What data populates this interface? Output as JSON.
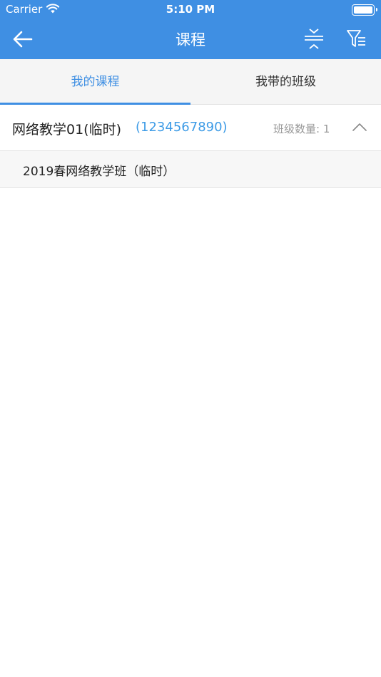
{
  "status_bar": {
    "carrier": "Carrier",
    "time": "5:10 PM"
  },
  "nav": {
    "title": "课程",
    "back_icon": "arrow-left-icon",
    "collapse_icon": "collapse-icon",
    "filter_icon": "filter-icon"
  },
  "tabs": [
    {
      "label": "我的课程",
      "active": true
    },
    {
      "label": "我带的班级",
      "active": false
    }
  ],
  "courses": [
    {
      "name": "网络教学01(临时)",
      "code": "(1234567890)",
      "class_count_label": "班级数量: 1",
      "expanded": true,
      "classes": [
        {
          "name": "2019春网络教学班（临时）"
        }
      ]
    }
  ],
  "colors": {
    "accent": "#3f8fe3",
    "code_text": "#3d9be6",
    "muted": "#999999"
  }
}
